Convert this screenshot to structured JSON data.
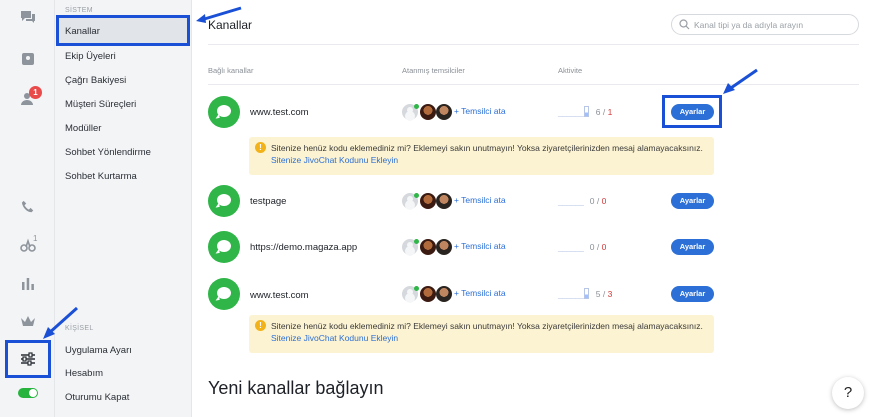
{
  "rail": {
    "chat_badge": "1",
    "sup_badge": "1"
  },
  "nav": {
    "section_system": "SİSTEM",
    "system_items": [
      "Kanallar",
      "Ekip Üyeleri",
      "Çağrı Bakiyesi",
      "Müşteri Süreçleri",
      "Modüller",
      "Sohbet Yönlendirme",
      "Sohbet Kurtarma"
    ],
    "section_personal": "KİŞİSEL",
    "personal_items": [
      "Uygulama Ayarı",
      "Hesabım",
      "Oturumu Kapat"
    ]
  },
  "main": {
    "title": "Kanallar",
    "search_placeholder": "Kanal tipi ya da adıyla arayın",
    "col_channels": "Bağlı kanallar",
    "col_agents": "Atanmış temsilciler",
    "col_activity": "Aktivite",
    "assign_label": "+ Temsilci ata",
    "settings_label": "Ayarlar",
    "channels": [
      {
        "name": "www.test.com",
        "act_a": "6",
        "act_b": "1"
      },
      {
        "name": "testpage",
        "act_a": "0",
        "act_b": "0"
      },
      {
        "name": "https://demo.magaza.app",
        "act_a": "0",
        "act_b": "0"
      },
      {
        "name": "www.test.com",
        "act_a": "5",
        "act_b": "3"
      }
    ],
    "warning_text": "Sitenize henüz kodu eklemediniz mi? Eklemeyi sakın unutmayın! Yoksa ziyaretçilerinizden mesaj alamayacaksınız.",
    "warning_link": "Sitenize JivoChat Kodunu Ekleyin",
    "new_title": "Yeni kanallar bağlayın",
    "help": "?"
  },
  "colors": {
    "accent": "#2c6fd6",
    "channel_green": "#2fb548",
    "annotation_blue": "#1a50d6",
    "warning_bg": "#fcf3d2"
  }
}
